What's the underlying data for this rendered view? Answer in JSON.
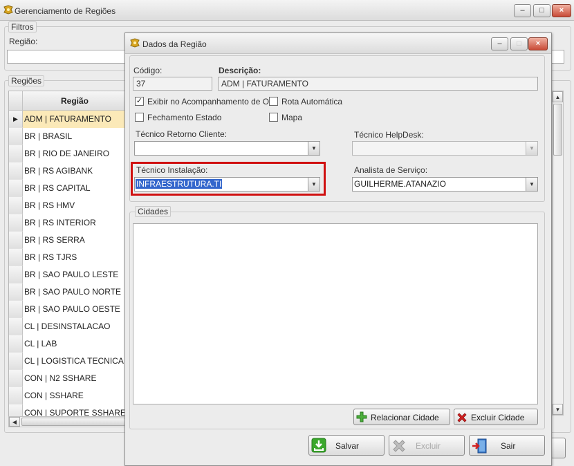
{
  "main_window": {
    "title": "Gerenciamento de Regiões",
    "buttons": {
      "minimize": "–",
      "maximize": "□",
      "close": "×"
    },
    "filters": {
      "legend": "Filtros",
      "region_label": "Região:"
    },
    "regions": {
      "legend": "Regiões",
      "column_header": "Região",
      "rows": [
        "ADM | FATURAMENTO",
        "BR | BRASIL",
        "BR | RIO DE JANEIRO",
        "BR | RS AGIBANK",
        "BR | RS CAPITAL",
        "BR | RS HMV",
        "BR | RS INTERIOR",
        "BR | RS SERRA",
        "BR | RS TJRS",
        "BR | SAO PAULO LESTE",
        "BR | SAO PAULO NORTE",
        "BR | SAO PAULO OESTE",
        "CL | DESINSTALACAO",
        "CL | LAB",
        "CL | LOGISTICA TECNICA",
        "CON | N2 SSHARE",
        "CON | SSHARE",
        "CON | SUPORTE SSHARE"
      ],
      "selected_index": 0
    }
  },
  "dialog": {
    "title": "Dados da Região",
    "codigo": {
      "label": "Código:",
      "value": "37"
    },
    "descricao": {
      "label": "Descrição:",
      "value": "ADM | FATURAMENTO"
    },
    "checkboxes": [
      {
        "label": "Exibir no Acompanhamento de OS",
        "checked": true
      },
      {
        "label": "Rota Automática",
        "checked": false
      },
      {
        "label": "Fechamento Estado",
        "checked": false
      },
      {
        "label": "Mapa",
        "checked": false
      }
    ],
    "tecnico_retorno": {
      "label": "Técnico Retorno Cliente:",
      "value": ""
    },
    "tecnico_helpdesk": {
      "label": "Técnico HelpDesk:",
      "value": ""
    },
    "tecnico_instalacao": {
      "label": "Técnico Instalação:",
      "value": "INFRAESTRUTURA.TI"
    },
    "analista_servico": {
      "label": "Analista de Serviço:",
      "value": "GUILHERME.ATANAZIO"
    },
    "cidades": {
      "legend": "Cidades"
    },
    "buttons": {
      "relacionar": "Relacionar Cidade",
      "excluir_cidade": "Excluir Cidade",
      "salvar": "Salvar",
      "excluir": "Excluir",
      "sair": "Sair"
    },
    "highlight_color": "#d01010",
    "selection_color": "#3366cc"
  }
}
